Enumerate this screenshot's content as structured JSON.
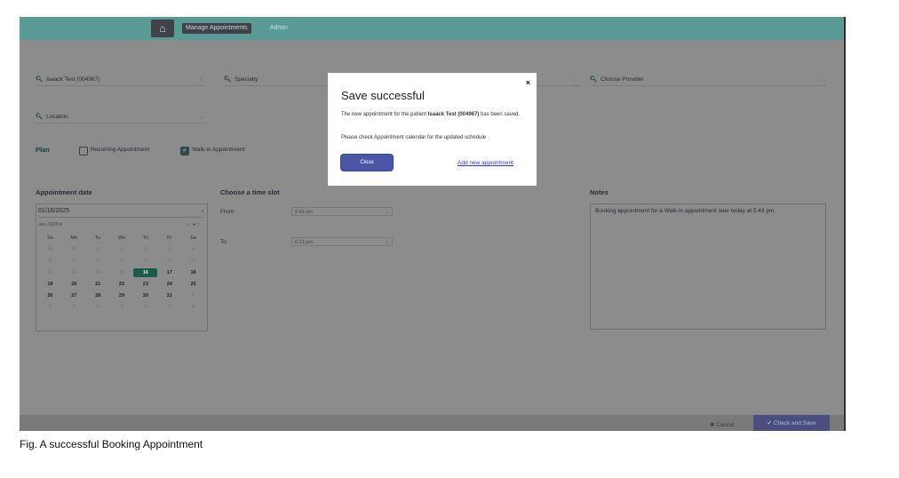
{
  "header": {
    "home_icon": "home-icon",
    "nav_active": "Manage Appointments",
    "nav_admin": "Admin"
  },
  "form": {
    "patient": "Isaack Test (004967)",
    "patient_clear": "×",
    "specialty": "Specialty",
    "provider": "Choose Provider",
    "location": "Location",
    "dropdown_arrow": "⌄"
  },
  "plan": {
    "label": "Plan",
    "recurring_label": "Recurring Appointment",
    "walkin_label": "Walk-in Appointment",
    "recurring_checked": false,
    "walkin_checked": true
  },
  "appointment_date": {
    "title": "Appointment date",
    "value": "01/16/2025",
    "month": "Jan 2025 ▾",
    "weekdays": [
      "Su",
      "Mo",
      "Tu",
      "We",
      "Th",
      "Fr",
      "Sa"
    ],
    "days": [
      {
        "d": "29",
        "c": "dim"
      },
      {
        "d": "30",
        "c": "dim"
      },
      {
        "d": "31",
        "c": "dim"
      },
      {
        "d": "1",
        "c": "dim"
      },
      {
        "d": "2",
        "c": "dim"
      },
      {
        "d": "3",
        "c": "dim"
      },
      {
        "d": "4",
        "c": "dim"
      },
      {
        "d": "5",
        "c": "dim"
      },
      {
        "d": "6",
        "c": "dim"
      },
      {
        "d": "7",
        "c": "dim"
      },
      {
        "d": "8",
        "c": "dim"
      },
      {
        "d": "9",
        "c": "dim"
      },
      {
        "d": "10",
        "c": "dim"
      },
      {
        "d": "11",
        "c": "dim"
      },
      {
        "d": "12",
        "c": "dim"
      },
      {
        "d": "13",
        "c": "dim"
      },
      {
        "d": "14",
        "c": "dim"
      },
      {
        "d": "15",
        "c": "dim"
      },
      {
        "d": "16",
        "c": "today"
      },
      {
        "d": "17",
        "c": "act"
      },
      {
        "d": "18",
        "c": "act"
      },
      {
        "d": "19",
        "c": "act"
      },
      {
        "d": "20",
        "c": "act"
      },
      {
        "d": "21",
        "c": "act"
      },
      {
        "d": "22",
        "c": "act"
      },
      {
        "d": "23",
        "c": "act"
      },
      {
        "d": "24",
        "c": "act"
      },
      {
        "d": "25",
        "c": "act"
      },
      {
        "d": "26",
        "c": "act"
      },
      {
        "d": "27",
        "c": "act"
      },
      {
        "d": "28",
        "c": "act"
      },
      {
        "d": "29",
        "c": "act"
      },
      {
        "d": "30",
        "c": "act"
      },
      {
        "d": "31",
        "c": "act"
      },
      {
        "d": "1",
        "c": "dim"
      },
      {
        "d": "2",
        "c": "dim"
      },
      {
        "d": "3",
        "c": "dim"
      },
      {
        "d": "4",
        "c": "dim"
      },
      {
        "d": "5",
        "c": "dim"
      },
      {
        "d": "6",
        "c": "dim"
      },
      {
        "d": "7",
        "c": "dim"
      },
      {
        "d": "8",
        "c": "dim"
      }
    ]
  },
  "time_slot": {
    "title": "Choose a time slot",
    "from_label": "From",
    "from_value": "5:43 pm",
    "to_label": "To",
    "to_value": "6:13 pm"
  },
  "notes": {
    "title": "Notes",
    "text": "Booking appointment for a Walk-in appointment later today at 5:43 pm."
  },
  "footer": {
    "cancel": "✖ Cancel",
    "save": "✔ Check and Save"
  },
  "modal": {
    "title": "Save successful",
    "close_icon": "×",
    "message_prefix": "The new appointment for the patient ",
    "message_patient": "Isaack Test (004967)",
    "message_suffix": " has been saved.",
    "message2": "Please check Appointment calendar for the updated schedule",
    "close_button": "Close",
    "add_link": "Add new appointment"
  },
  "caption": "Fig. A successful Booking Appointment"
}
